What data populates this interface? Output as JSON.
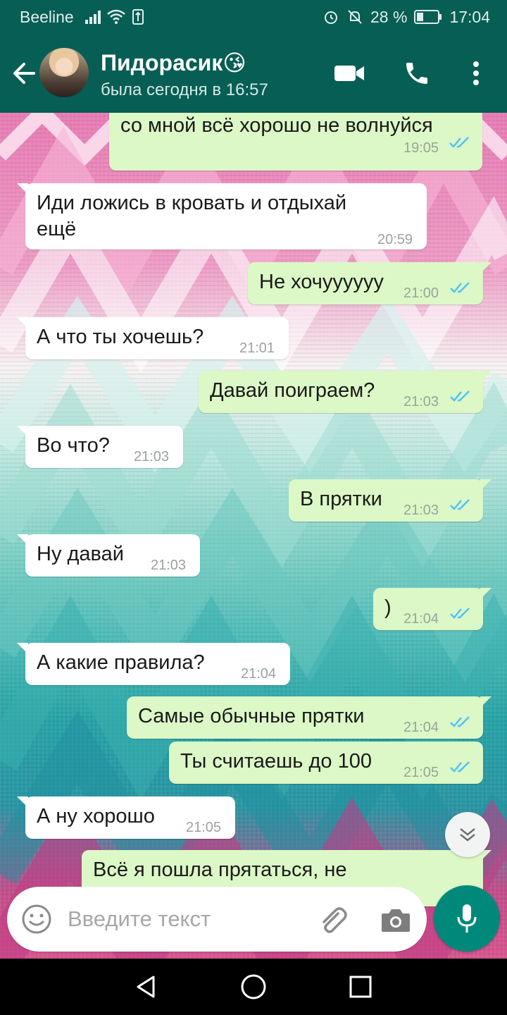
{
  "status_bar": {
    "carrier": "Beeline",
    "battery_percent": "28 %",
    "time": "17:04"
  },
  "header": {
    "contact_name": "Пидорасик😘",
    "last_seen": "была сегодня в 16:57",
    "icons": [
      "back-arrow-icon",
      "avatar",
      "video-call-icon",
      "phone-icon",
      "more-vert-icon"
    ]
  },
  "messages": [
    {
      "dir": "out",
      "text": "со мной всё хорошо не волнуйся",
      "time": "19:05",
      "read": true
    },
    {
      "dir": "in",
      "text_line1": "Иди ложись в кровать и отдыхай",
      "text_line2": "ещё",
      "time": "20:59"
    },
    {
      "dir": "out",
      "text": "Не хочуууууу",
      "time": "21:00",
      "read": true
    },
    {
      "dir": "in",
      "text": "А что ты хочешь?",
      "time": "21:01"
    },
    {
      "dir": "out",
      "text": "Давай поиграем?",
      "time": "21:03",
      "read": true
    },
    {
      "dir": "in",
      "text": "Во что?",
      "time": "21:03"
    },
    {
      "dir": "out",
      "text": "В прятки",
      "time": "21:03",
      "read": true
    },
    {
      "dir": "in",
      "text": "Ну давай",
      "time": "21:03"
    },
    {
      "dir": "out",
      "text": ")",
      "time": "21:04",
      "read": true
    },
    {
      "dir": "in",
      "text": "А какие правила?",
      "time": "21:04"
    },
    {
      "dir": "out",
      "text": "Самые обычные прятки",
      "time": "21:04",
      "read": true
    },
    {
      "dir": "out",
      "text": "Ты считаешь до 100",
      "time": "21:05",
      "read": true
    },
    {
      "dir": "in",
      "text": "А ну хорошо",
      "time": "21:05"
    },
    {
      "dir": "out",
      "text": "Всё я пошла прятаться, не"
    }
  ],
  "composer": {
    "placeholder": "Введите текст"
  },
  "colors": {
    "header": "#075e54",
    "outgoing_bubble": "#dcf8c6",
    "incoming_bubble": "#ffffff",
    "read_ticks": "#4fc3f7",
    "mic_button": "#00897b"
  }
}
